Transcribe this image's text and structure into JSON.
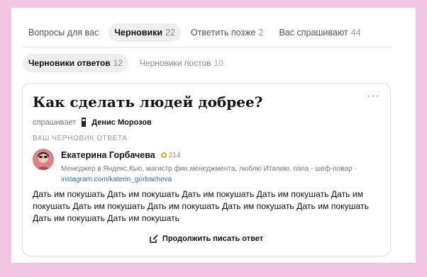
{
  "tabs": [
    {
      "label": "Вопросы для вас",
      "count": ""
    },
    {
      "label": "Черновики",
      "count": "22"
    },
    {
      "label": "Ответить позже",
      "count": "2"
    },
    {
      "label": "Вас спрашивают",
      "count": "44"
    }
  ],
  "subtabs": [
    {
      "label": "Черновики ответов",
      "count": "12"
    },
    {
      "label": "Черновики постов",
      "count": "10"
    }
  ],
  "card": {
    "more": "···",
    "question_title": "Как сделать людей добрее?",
    "asked_by_label": "спрашивает",
    "asker_name": "Денис Морозов",
    "draft_label": "ВАШ ЧЕРНОВИК ОТВЕТА",
    "author_name": "Екатерина Горбачева",
    "author_rating": "214",
    "author_bio": "Менеджер в Яндекс.Кью, магистр фин.менеджмента, люблю Италию, папа - шеф-повар ·",
    "author_link": "instagram.com/katerin_gorbacheva",
    "answer_text": "Дать им покушать Дать им покушать Дать им покушать Дать им покушать Дать им покушать Дать им покушать Дать им покушать Дать им покушать Дать им покушать Дать им покушать Дать им покушать",
    "continue_label": "Продолжить писать ответ"
  },
  "colors": {
    "background": "#f2c4e4",
    "link": "#2b6cd4",
    "rating_coin": "#e0a43b"
  }
}
